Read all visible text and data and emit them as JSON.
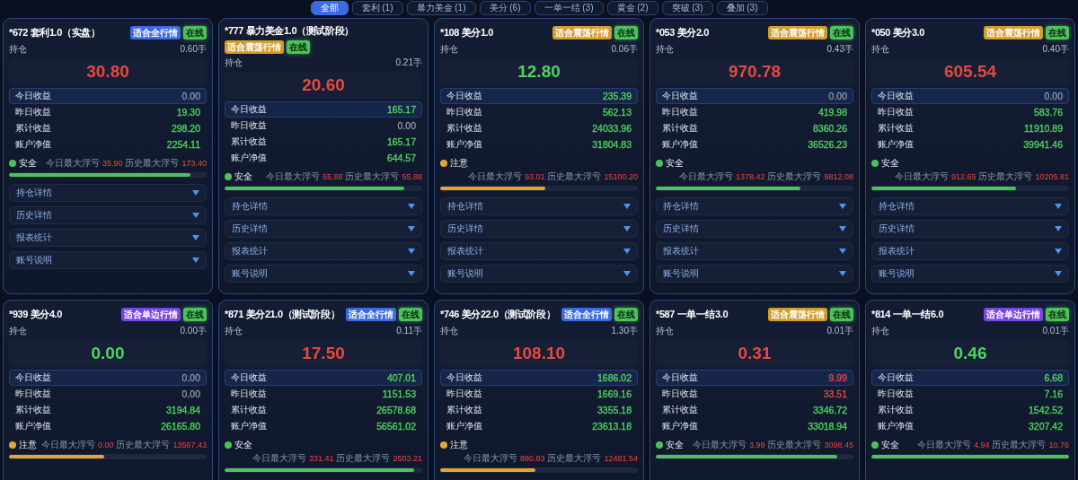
{
  "tabs": [
    {
      "label": "全部",
      "selected": true
    },
    {
      "label": "套利 (1)",
      "selected": false
    },
    {
      "label": "暴力美金 (1)",
      "selected": false
    },
    {
      "label": "美分 (6)",
      "selected": false
    },
    {
      "label": "一单一结 (3)",
      "selected": false
    },
    {
      "label": "黄金 (2)",
      "selected": false
    },
    {
      "label": "突破 (3)",
      "selected": false
    },
    {
      "label": "叠加 (3)",
      "selected": false
    }
  ],
  "cards": [
    {
      "title": "*672 套利1.0（实盘）",
      "tags": [
        {
          "label": "适合全行情",
          "color": "#3a6be0"
        }
      ],
      "status": "在线",
      "position_label": "持仓",
      "position": "0.60手",
      "pnl": {
        "value": "30.80",
        "color": "#e5493f"
      },
      "stats": [
        {
          "label": "今日收益",
          "value": "0.00",
          "color": "#8a94a6"
        },
        {
          "label": "昨日收益",
          "value": "19.30",
          "color": "#4fd35f"
        },
        {
          "label": "累计收益",
          "value": "298.20",
          "color": "#4fd35f"
        },
        {
          "label": "账户净值",
          "value": "2254.11",
          "color": "#4fd35f"
        }
      ],
      "risk": {
        "kind": "safe",
        "label": "安全",
        "level": 0.92,
        "today_label": "今日最大浮亏",
        "today_value": "35.90",
        "history_label": "历史最大浮亏",
        "history_value": "173.40"
      },
      "sections": [
        "持仓详情",
        "历史详情",
        "报表统计",
        "账号说明"
      ]
    },
    {
      "title": "*777 暴力美金1.0（测试阶段）",
      "tags": [
        {
          "label": "适合震荡行情",
          "color": "#d19d2f"
        }
      ],
      "status": "在线",
      "position_label": "持仓",
      "position": "0.21手",
      "pnl": {
        "value": "20.60",
        "color": "#e5493f"
      },
      "stats": [
        {
          "label": "今日收益",
          "value": "165.17",
          "color": "#4fd35f"
        },
        {
          "label": "昨日收益",
          "value": "0.00",
          "color": "#8a94a6"
        },
        {
          "label": "累计收益",
          "value": "165.17",
          "color": "#4fd35f"
        },
        {
          "label": "账户净值",
          "value": "644.57",
          "color": "#4fd35f"
        }
      ],
      "risk": {
        "kind": "safe",
        "label": "安全",
        "level": 0.91,
        "today_label": "今日最大浮亏",
        "today_value": "55.88",
        "history_label": "历史最大浮亏",
        "history_value": "55.88"
      },
      "sections": [
        "持仓详情",
        "历史详情",
        "报表统计",
        "账号说明"
      ]
    },
    {
      "title": "*108 美分1.0",
      "tags": [
        {
          "label": "适合震荡行情",
          "color": "#d19d2f"
        }
      ],
      "status": "在线",
      "position_label": "持仓",
      "position": "0.06手",
      "pnl": {
        "value": "12.80",
        "color": "#4fd35f"
      },
      "stats": [
        {
          "label": "今日收益",
          "value": "235.39",
          "color": "#4fd35f"
        },
        {
          "label": "昨日收益",
          "value": "562.13",
          "color": "#4fd35f"
        },
        {
          "label": "累计收益",
          "value": "24033.96",
          "color": "#4fd35f"
        },
        {
          "label": "账户净值",
          "value": "31804.83",
          "color": "#4fd35f"
        }
      ],
      "risk": {
        "kind": "warn",
        "label": "注意",
        "level": 0.53,
        "today_label": "今日最大浮亏",
        "today_value": "93.01",
        "history_label": "历史最大浮亏",
        "history_value": "15100.20"
      },
      "sections": [
        "持仓详情",
        "历史详情",
        "报表统计",
        "账号说明"
      ]
    },
    {
      "title": "*053 美分2.0",
      "tags": [
        {
          "label": "适合震荡行情",
          "color": "#d19d2f"
        }
      ],
      "status": "在线",
      "position_label": "持仓",
      "position": "0.43手",
      "pnl": {
        "value": "970.78",
        "color": "#e5493f"
      },
      "stats": [
        {
          "label": "今日收益",
          "value": "0.00",
          "color": "#8a94a6"
        },
        {
          "label": "昨日收益",
          "value": "419.98",
          "color": "#4fd35f"
        },
        {
          "label": "累计收益",
          "value": "8360.26",
          "color": "#4fd35f"
        },
        {
          "label": "账户净值",
          "value": "36526.23",
          "color": "#4fd35f"
        }
      ],
      "risk": {
        "kind": "safe",
        "label": "安全",
        "level": 0.73,
        "today_label": "今日最大浮亏",
        "today_value": "1378.42",
        "history_label": "历史最大浮亏",
        "history_value": "9812.08"
      },
      "sections": [
        "持仓详情",
        "历史详情",
        "报表统计",
        "账号说明"
      ]
    },
    {
      "title": "*050 美分3.0",
      "tags": [
        {
          "label": "适合震荡行情",
          "color": "#d19d2f"
        }
      ],
      "status": "在线",
      "position_label": "持仓",
      "position": "0.40手",
      "pnl": {
        "value": "605.54",
        "color": "#e5493f"
      },
      "stats": [
        {
          "label": "今日收益",
          "value": "0.00",
          "color": "#8a94a6"
        },
        {
          "label": "昨日收益",
          "value": "583.76",
          "color": "#4fd35f"
        },
        {
          "label": "累计收益",
          "value": "11910.89",
          "color": "#4fd35f"
        },
        {
          "label": "账户净值",
          "value": "39941.46",
          "color": "#4fd35f"
        }
      ],
      "risk": {
        "kind": "safe",
        "label": "安全",
        "level": 0.73,
        "today_label": "今日最大浮亏",
        "today_value": "912.65",
        "history_label": "历史最大浮亏",
        "history_value": "10205.81"
      },
      "sections": [
        "持仓详情",
        "历史详情",
        "报表统计",
        "账号说明"
      ]
    },
    {
      "title": "*939 美分4.0",
      "tags": [
        {
          "label": "适合单边行情",
          "color": "#7a45e0"
        }
      ],
      "status": "在线",
      "position_label": "持仓",
      "position": "0.00手",
      "pnl": {
        "value": "0.00",
        "color": "#4fd35f"
      },
      "stats": [
        {
          "label": "今日收益",
          "value": "0.00",
          "color": "#8a94a6"
        },
        {
          "label": "昨日收益",
          "value": "0.00",
          "color": "#8a94a6"
        },
        {
          "label": "累计收益",
          "value": "3194.84",
          "color": "#4fd35f"
        },
        {
          "label": "账户净值",
          "value": "26165.80",
          "color": "#4fd35f"
        }
      ],
      "risk": {
        "kind": "warn",
        "label": "注意",
        "level": 0.48,
        "today_label": "今日最大浮亏",
        "today_value": "0.00",
        "history_label": "历史最大浮亏",
        "history_value": "13567.43"
      }
    },
    {
      "title": "*871 美分21.0（测试阶段）",
      "tags": [
        {
          "label": "适合全行情",
          "color": "#3a6be0"
        }
      ],
      "status": "在线",
      "position_label": "持仓",
      "position": "0.11手",
      "pnl": {
        "value": "17.50",
        "color": "#e5493f"
      },
      "stats": [
        {
          "label": "今日收益",
          "value": "407.01",
          "color": "#4fd35f"
        },
        {
          "label": "昨日收益",
          "value": "1151.53",
          "color": "#4fd35f"
        },
        {
          "label": "累计收益",
          "value": "26578.68",
          "color": "#4fd35f"
        },
        {
          "label": "账户净值",
          "value": "56561.02",
          "color": "#4fd35f"
        }
      ],
      "risk": {
        "kind": "safe",
        "label": "安全",
        "level": 0.96,
        "today_label": "今日最大浮亏",
        "today_value": "331.41",
        "history_label": "历史最大浮亏",
        "history_value": "2503.21"
      }
    },
    {
      "title": "*746 美分22.0（测试阶段）",
      "tags": [
        {
          "label": "适合全行情",
          "color": "#3a6be0"
        }
      ],
      "status": "在线",
      "position_label": "持仓",
      "position": "1.30手",
      "pnl": {
        "value": "108.10",
        "color": "#e5493f"
      },
      "stats": [
        {
          "label": "今日收益",
          "value": "1686.02",
          "color": "#4fd35f"
        },
        {
          "label": "昨日收益",
          "value": "1669.16",
          "color": "#4fd35f"
        },
        {
          "label": "累计收益",
          "value": "3355.18",
          "color": "#4fd35f"
        },
        {
          "label": "账户净值",
          "value": "23613.18",
          "color": "#4fd35f"
        }
      ],
      "risk": {
        "kind": "warn",
        "label": "注意",
        "level": 0.48,
        "today_label": "今日最大浮亏",
        "today_value": "880.83",
        "history_label": "历史最大浮亏",
        "history_value": "12481.54"
      }
    },
    {
      "title": "*587 一单一结3.0",
      "tags": [
        {
          "label": "适合震荡行情",
          "color": "#d19d2f"
        }
      ],
      "status": "在线",
      "position_label": "持仓",
      "position": "0.01手",
      "pnl": {
        "value": "0.31",
        "color": "#e5493f"
      },
      "stats": [
        {
          "label": "今日收益",
          "value": "9.99",
          "color": "#e5493f"
        },
        {
          "label": "昨日收益",
          "value": "33.51",
          "color": "#e5493f"
        },
        {
          "label": "累计收益",
          "value": "3346.72",
          "color": "#4fd35f"
        },
        {
          "label": "账户净值",
          "value": "33018.94",
          "color": "#4fd35f"
        }
      ],
      "risk": {
        "kind": "safe",
        "label": "安全",
        "level": 0.92,
        "today_label": "今日最大浮亏",
        "today_value": "3.99",
        "history_label": "历史最大浮亏",
        "history_value": "3098.45"
      }
    },
    {
      "title": "*814 一单一结6.0",
      "tags": [
        {
          "label": "适合单边行情",
          "color": "#7a45e0"
        }
      ],
      "status": "在线",
      "position_label": "持仓",
      "position": "0.01手",
      "pnl": {
        "value": "0.46",
        "color": "#4fd35f"
      },
      "stats": [
        {
          "label": "今日收益",
          "value": "6.68",
          "color": "#4fd35f"
        },
        {
          "label": "昨日收益",
          "value": "7.16",
          "color": "#4fd35f"
        },
        {
          "label": "累计收益",
          "value": "1542.52",
          "color": "#4fd35f"
        },
        {
          "label": "账户净值",
          "value": "3207.42",
          "color": "#4fd35f"
        }
      ],
      "risk": {
        "kind": "safe",
        "label": "安全",
        "level": 1.0,
        "today_label": "今日最大浮亏",
        "today_value": "4.94",
        "history_label": "历史最大浮亏",
        "history_value": "10.76"
      }
    }
  ]
}
